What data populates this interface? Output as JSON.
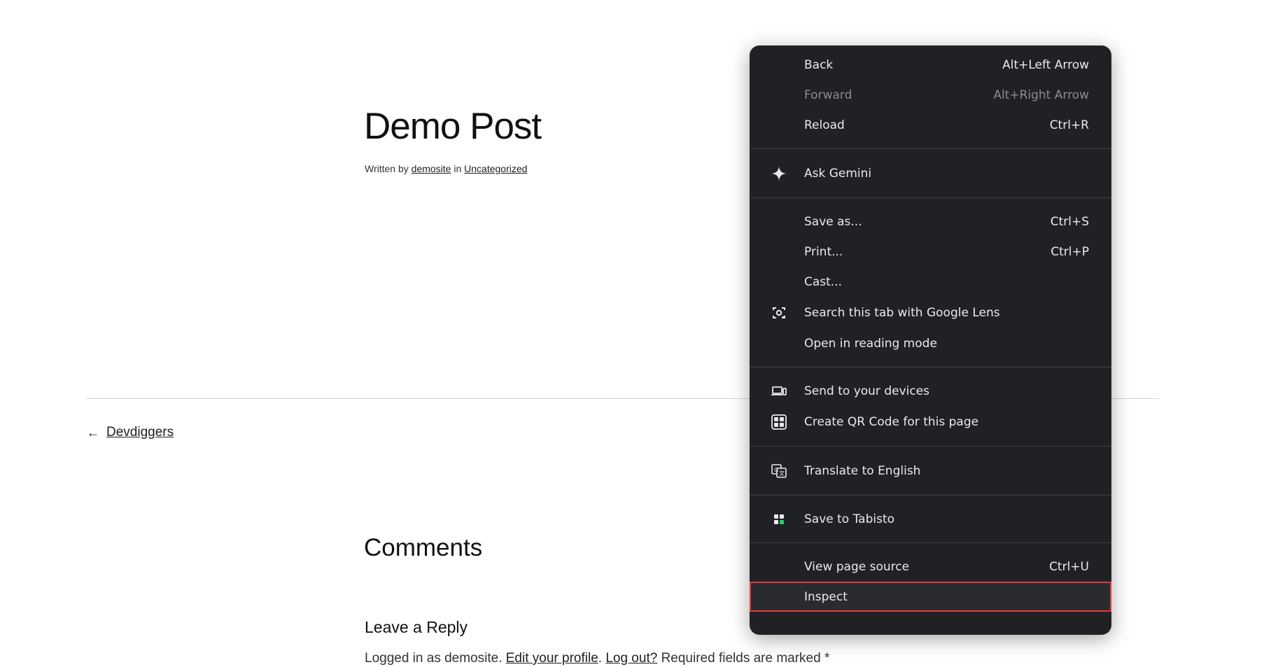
{
  "post": {
    "title": "Demo Post",
    "meta_written_by": "Written by",
    "meta_author": "demosite",
    "meta_in": "in",
    "meta_category": "Uncategorized"
  },
  "navigation": {
    "prev_arrow": "←",
    "prev_label": "Devdiggers"
  },
  "comments": {
    "title": "Comments",
    "reply_title": "Leave a Reply",
    "logged_in_prefix": "Logged in as demosite.",
    "edit_profile": "Edit your profile",
    "log_out": "Log out?",
    "required_text": "Required fields are marked *"
  },
  "context_menu": {
    "back": {
      "label": "Back",
      "shortcut": "Alt+Left Arrow"
    },
    "forward": {
      "label": "Forward",
      "shortcut": "Alt+Right Arrow"
    },
    "reload": {
      "label": "Reload",
      "shortcut": "Ctrl+R"
    },
    "ask_gemini": {
      "label": "Ask Gemini",
      "icon": "sparkle-icon"
    },
    "save_as": {
      "label": "Save as...",
      "shortcut": "Ctrl+S"
    },
    "print": {
      "label": "Print...",
      "shortcut": "Ctrl+P"
    },
    "cast": {
      "label": "Cast..."
    },
    "google_lens": {
      "label": "Search this tab with Google Lens",
      "icon": "lens-icon"
    },
    "reading_mode": {
      "label": "Open in reading mode"
    },
    "send_devices": {
      "label": "Send to your devices",
      "icon": "devices-icon"
    },
    "qr_code": {
      "label": "Create QR Code for this page",
      "icon": "qr-code-icon"
    },
    "translate": {
      "label": "Translate to English",
      "icon": "translate-icon"
    },
    "tabisto": {
      "label": "Save to Tabisto",
      "icon": "tabisto-icon"
    },
    "view_source": {
      "label": "View page source",
      "shortcut": "Ctrl+U"
    },
    "inspect": {
      "label": "Inspect"
    }
  },
  "colors": {
    "menu_background": "#202124",
    "highlight_border": "#e53935"
  }
}
